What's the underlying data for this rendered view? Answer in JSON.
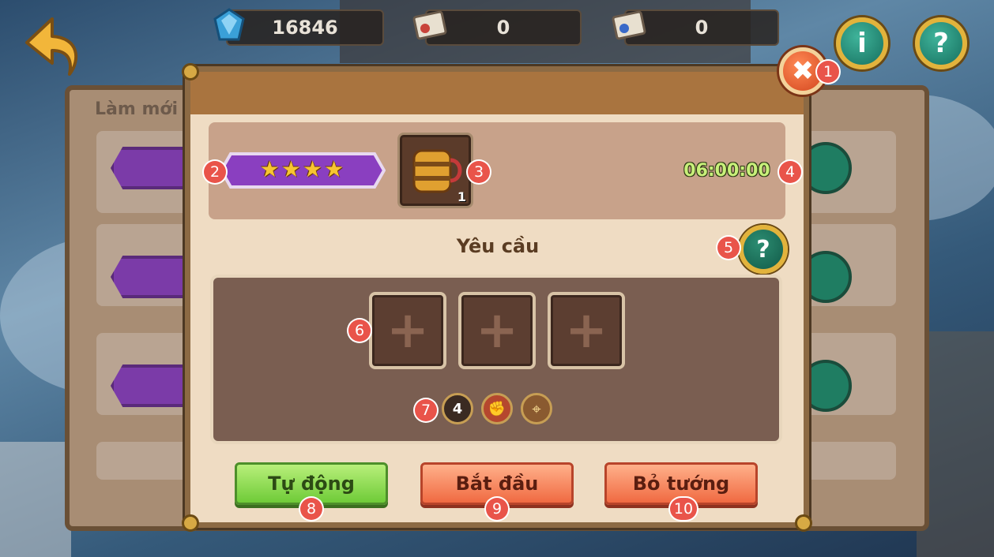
{
  "top_bar": {
    "gems": "16846",
    "letters_1": "0",
    "letters_2": "0",
    "info_icon": "i",
    "help_icon": "?"
  },
  "background": {
    "refresh_label": "Làm mới"
  },
  "dialog": {
    "close_glyph": "✖",
    "stars": "★★★★",
    "reward_item": {
      "icon": "barrel-mug-icon",
      "count": "1"
    },
    "timer": "06:00:00",
    "requirement_title": "Yêu cầu",
    "requirement_help": "?",
    "slots": [
      "+",
      "+",
      "+"
    ],
    "requirement_icons": [
      {
        "name": "level-4-icon",
        "label": "4"
      },
      {
        "name": "fist-icon",
        "label": "✊"
      },
      {
        "name": "target-icon",
        "label": "⌖"
      }
    ],
    "buttons": {
      "auto": "Tự động",
      "start": "Bắt đầu",
      "remove": "Bỏ tướng"
    }
  },
  "markers": [
    "1",
    "2",
    "3",
    "4",
    "5",
    "6",
    "7",
    "8",
    "9",
    "10"
  ],
  "colors": {
    "badge_purple": "#7b3ba8",
    "timer_green": "#c8f07a",
    "accent_gold": "#e2b33c",
    "button_green": "#6fcb38",
    "button_orange": "#f06a42"
  }
}
